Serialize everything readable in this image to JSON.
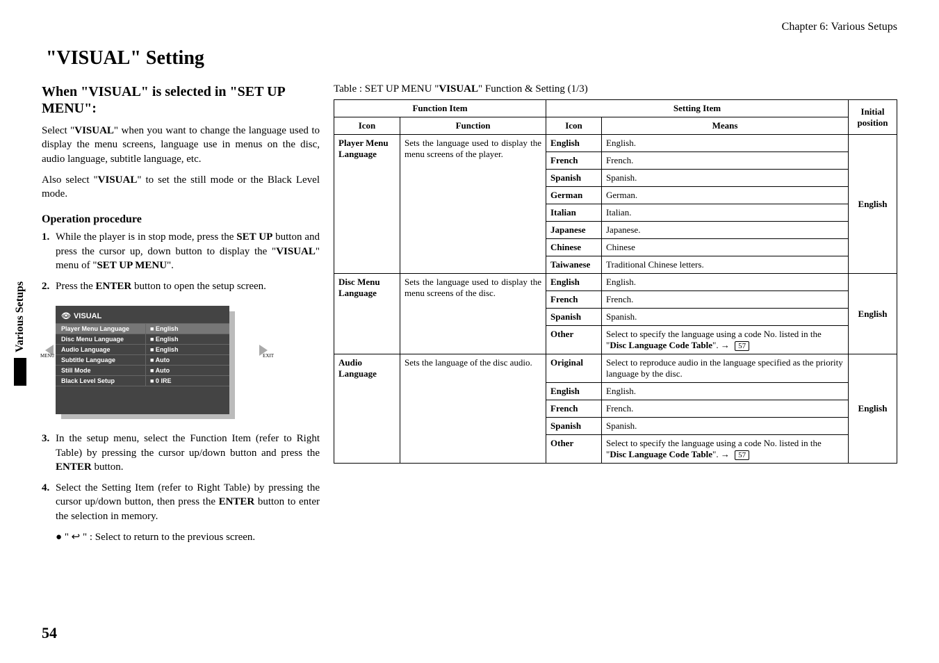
{
  "chapter_label": "Chapter 6: Various Setups",
  "page_title": "\"VISUAL\" Setting",
  "subheading": "When \"VISUAL\" is selected in \"SET UP MENU\":",
  "intro_p1_a": "Select \"",
  "intro_p1_b": "VISUAL",
  "intro_p1_c": "\" when you want to change the language used to display the menu screens, language use in menus on the disc, audio language, subtitle language, etc.",
  "intro_p2_a": "Also select \"",
  "intro_p2_b": "VISUAL",
  "intro_p2_c": "\" to set the still mode or the Black Level mode.",
  "op_procedure_heading": "Operation procedure",
  "step1_num": "1.",
  "step1_a": "While the player is in stop mode, press the ",
  "step1_b": "SET UP",
  "step1_c": " button and press the cursor up, down button to display the \"",
  "step1_d": "VISUAL",
  "step1_e": "\" menu of \"",
  "step1_f": "SET UP MENU",
  "step1_g": "\".",
  "step2_num": "2.",
  "step2_a": "Press the ",
  "step2_b": "ENTER",
  "step2_c": " button to open the setup screen.",
  "osd": {
    "title": "VISUAL",
    "menu_tab": "MENU",
    "exit_tab": "EXIT",
    "rows": [
      {
        "label": "Player Menu Language",
        "value": "English"
      },
      {
        "label": "Disc Menu Language",
        "value": "English"
      },
      {
        "label": "Audio Language",
        "value": "English"
      },
      {
        "label": "Subtitle Language",
        "value": "Auto"
      },
      {
        "label": "Still Mode",
        "value": "Auto"
      },
      {
        "label": "Black Level Setup",
        "value": "0 IRE"
      }
    ]
  },
  "step3_num": "3.",
  "step3_a": "In the setup menu, select the Function Item (refer to Right Table) by pressing the cursor up/down button and press the ",
  "step3_b": "ENTER",
  "step3_c": " button.",
  "step4_num": "4.",
  "step4_a": "Select the Setting Item (refer to Right Table) by pressing the cursor up/down button, then press the ",
  "step4_b": "ENTER",
  "step4_c": " button to enter the selection in memory.",
  "bullet_return": "\" ↩ \"  :  Select to return to the previous screen.",
  "side_tab": "Various Setups",
  "page_number": "54",
  "table_caption_a": "Table : SET UP MENU \"",
  "table_caption_b": "VISUAL",
  "table_caption_c": "\" Function & Setting (1/3)",
  "headers": {
    "function_item": "Function Item",
    "setting_item": "Setting Item",
    "initial_position": "Initial position",
    "icon": "Icon",
    "function": "Function",
    "means": "Means"
  },
  "groups": [
    {
      "icon": "Player Menu Language",
      "desc": "Sets the language used to display the menu screens of the player.",
      "initial": "English",
      "settings": [
        {
          "icon": "English",
          "means": "English."
        },
        {
          "icon": "French",
          "means": "French."
        },
        {
          "icon": "Spanish",
          "means": "Spanish."
        },
        {
          "icon": "German",
          "means": "German."
        },
        {
          "icon": "Italian",
          "means": "Italian."
        },
        {
          "icon": "Japanese",
          "means": "Japanese."
        },
        {
          "icon": "Chinese",
          "means": "Chinese"
        },
        {
          "icon": "Taiwanese",
          "means": "Traditional Chinese letters."
        }
      ]
    },
    {
      "icon": "Disc Menu Language",
      "desc": "Sets the language used to display the menu screens of the disc.",
      "initial": "English",
      "settings": [
        {
          "icon": "English",
          "means": "English."
        },
        {
          "icon": "French",
          "means": "French."
        },
        {
          "icon": "Spanish",
          "means": "Spanish."
        },
        {
          "icon": "Other",
          "means_a": "Select to specify the language using a code No. listed in the \"",
          "means_b": "Disc Language Code Table",
          "means_c": "\".",
          "page_ref": "57"
        }
      ]
    },
    {
      "icon": "Audio Language",
      "desc": "Sets the language of the disc audio.",
      "initial": "English",
      "settings": [
        {
          "icon": "Original",
          "means": "Select to reproduce audio in the language specified as the priority language by the disc."
        },
        {
          "icon": "English",
          "means": "English."
        },
        {
          "icon": "French",
          "means": "French."
        },
        {
          "icon": "Spanish",
          "means": "Spanish."
        },
        {
          "icon": "Other",
          "means_a": "Select to specify the language using a code No. listed in the \"",
          "means_b": "Disc Language Code Table",
          "means_c": "\".",
          "page_ref": "57"
        }
      ]
    }
  ]
}
